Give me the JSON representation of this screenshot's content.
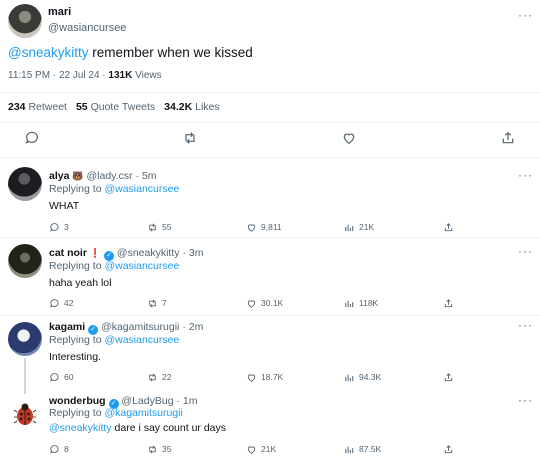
{
  "main_tweet": {
    "name": "mari",
    "handle": "@wasiancursee",
    "mention": "@sneakykitty",
    "text": " remember when we kissed",
    "time": "11:15 PM · 22 Jul 24 · ",
    "views_count": "131K",
    "views_label": " Views",
    "retweets_count": "234",
    "retweets_label": " Retweet",
    "quotes_count": "55",
    "quotes_label": " Quote Tweets",
    "likes_count": "34.2K",
    "likes_label": " Likes",
    "more": "···"
  },
  "replies": [
    {
      "name": "alya",
      "name_mark": "🐻",
      "handle": "@lady.csr",
      "dot": "·",
      "age": "5m",
      "replying_label": "Replying to ",
      "replying_to": "@wasiancursee",
      "mention": "",
      "text": "WHAT",
      "replies": "3",
      "retweets": "55",
      "likes": "9,811",
      "views": "21K",
      "more": "···"
    },
    {
      "name": "cat noir",
      "name_mark": "❗",
      "handle": "@sneakykitty",
      "dot": "·",
      "age": "3m",
      "replying_label": "Replying to ",
      "replying_to": "@wasiancursee",
      "mention": "",
      "text": "haha yeah lol",
      "replies": "42",
      "retweets": "7",
      "likes": "30.1K",
      "views": "118K",
      "more": "···"
    },
    {
      "name": "kagami",
      "name_mark": "✓",
      "handle": "@kagamitsurugii",
      "dot": "·",
      "age": "2m",
      "replying_label": "Replying to ",
      "replying_to": "@wasiancursee",
      "mention": "",
      "text": "Interesting.",
      "replies": "60",
      "retweets": "22",
      "likes": "18.7K",
      "views": "94.3K",
      "more": "···"
    },
    {
      "name": "wonderbug",
      "name_mark": "✓",
      "handle": "@LadyBug",
      "dot": "·",
      "age": "1m",
      "replying_label": "Replying to ",
      "replying_to": "@kagamitsurugii",
      "mention": "@sneakykitty",
      "text": " dare i say count ur days",
      "replies": "8",
      "retweets": "35",
      "likes": "21K",
      "views": "87.5K",
      "more": "···"
    }
  ],
  "colors": {
    "accent": "#1d9bf0",
    "muted": "#536471",
    "text": "#0f1419",
    "divider": "#eff3f4"
  },
  "icons": [
    "reply-icon",
    "retweet-icon",
    "like-icon",
    "share-icon",
    "views-icon",
    "more-icon",
    "verified-badge-icon",
    "ladybug-avatar-icon"
  ]
}
